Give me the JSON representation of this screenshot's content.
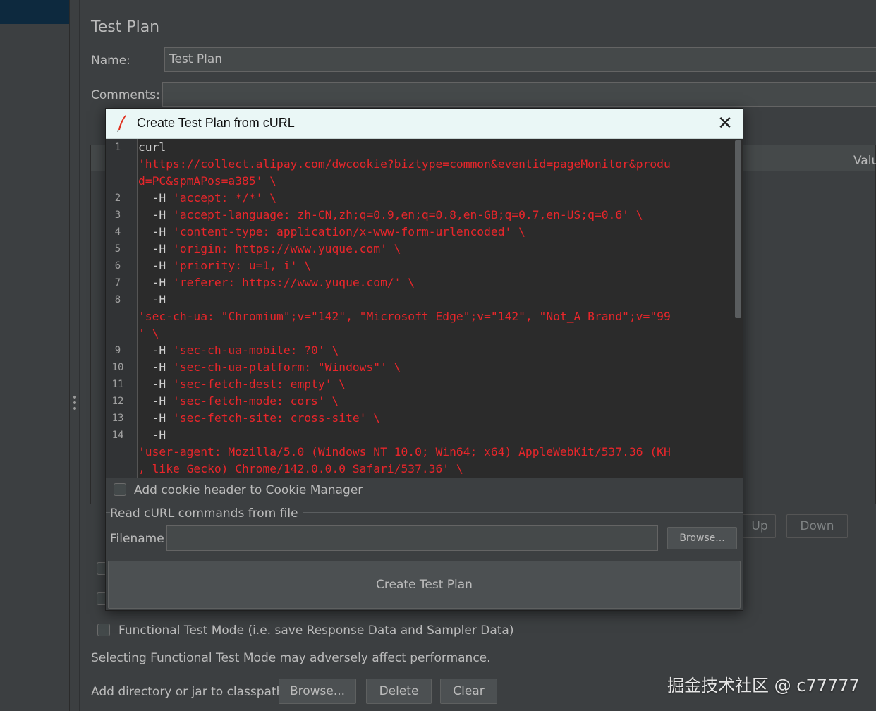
{
  "panel": {
    "title": "Test Plan",
    "name_label": "Name:",
    "name_value": "Test Plan",
    "comments_label": "Comments:",
    "comments_value": "",
    "table_col_value": "Valu",
    "up_label": "Up",
    "down_label": "Down",
    "functional_mode_label": "Functional Test Mode (i.e. save Response Data and Sampler Data)",
    "functional_mode_note": "Selecting Functional Test Mode may adversely affect performance.",
    "classpath_label": "Add directory or jar to classpath",
    "browse_label": "Browse...",
    "delete_label": "Delete",
    "clear_label": "Clear"
  },
  "dialog": {
    "title": "Create Test Plan from cURL",
    "close_icon": "close-icon",
    "code_lines": [
      {
        "num": "1",
        "segs": [
          {
            "t": "curl",
            "c": "plain"
          }
        ]
      },
      {
        "num": "",
        "segs": [
          {
            "t": "'https://collect.alipay.com/dwcookie?biztype=common&eventid=pageMonitor&produ",
            "c": "str"
          }
        ]
      },
      {
        "num": "",
        "segs": [
          {
            "t": "d=PC&spmAPos=a385' \\",
            "c": "str"
          }
        ]
      },
      {
        "num": "2",
        "segs": [
          {
            "t": "  -H ",
            "c": "plain"
          },
          {
            "t": "'accept: */*' \\",
            "c": "str"
          }
        ]
      },
      {
        "num": "3",
        "segs": [
          {
            "t": "  -H ",
            "c": "plain"
          },
          {
            "t": "'accept-language: zh-CN,zh;q=0.9,en;q=0.8,en-GB;q=0.7,en-US;q=0.6' \\",
            "c": "str"
          }
        ]
      },
      {
        "num": "4",
        "segs": [
          {
            "t": "  -H ",
            "c": "plain"
          },
          {
            "t": "'content-type: application/x-www-form-urlencoded' \\",
            "c": "str"
          }
        ]
      },
      {
        "num": "5",
        "segs": [
          {
            "t": "  -H ",
            "c": "plain"
          },
          {
            "t": "'origin: https://www.yuque.com' \\",
            "c": "str"
          }
        ]
      },
      {
        "num": "6",
        "segs": [
          {
            "t": "  -H ",
            "c": "plain"
          },
          {
            "t": "'priority: u=1, i' \\",
            "c": "str"
          }
        ]
      },
      {
        "num": "7",
        "segs": [
          {
            "t": "  -H ",
            "c": "plain"
          },
          {
            "t": "'referer: https://www.yuque.com/' \\",
            "c": "str"
          }
        ]
      },
      {
        "num": "8",
        "segs": [
          {
            "t": "  -H",
            "c": "plain"
          }
        ]
      },
      {
        "num": "",
        "segs": [
          {
            "t": "'sec-ch-ua: \"Chromium\";v=\"142\", \"Microsoft Edge\";v=\"142\", \"Not_A Brand\";v=\"99",
            "c": "str"
          }
        ]
      },
      {
        "num": "",
        "segs": [
          {
            "t": "' \\",
            "c": "str"
          }
        ]
      },
      {
        "num": "9",
        "segs": [
          {
            "t": "  -H ",
            "c": "plain"
          },
          {
            "t": "'sec-ch-ua-mobile: ?0' \\",
            "c": "str"
          }
        ]
      },
      {
        "num": "10",
        "segs": [
          {
            "t": "  -H ",
            "c": "plain"
          },
          {
            "t": "'sec-ch-ua-platform: \"Windows\"' \\",
            "c": "str"
          }
        ]
      },
      {
        "num": "11",
        "segs": [
          {
            "t": "  -H ",
            "c": "plain"
          },
          {
            "t": "'sec-fetch-dest: empty' \\",
            "c": "str"
          }
        ]
      },
      {
        "num": "12",
        "segs": [
          {
            "t": "  -H ",
            "c": "plain"
          },
          {
            "t": "'sec-fetch-mode: cors' \\",
            "c": "str"
          }
        ]
      },
      {
        "num": "13",
        "segs": [
          {
            "t": "  -H ",
            "c": "plain"
          },
          {
            "t": "'sec-fetch-site: cross-site' \\",
            "c": "str"
          }
        ]
      },
      {
        "num": "14",
        "segs": [
          {
            "t": "  -H",
            "c": "plain"
          }
        ]
      },
      {
        "num": "",
        "segs": [
          {
            "t": "'user-agent: Mozilla/5.0 (Windows NT 10.0; Win64; x64) AppleWebKit/537.36 (KH",
            "c": "str"
          }
        ]
      },
      {
        "num": "",
        "segs": [
          {
            "t": ", like Gecko) Chrome/142.0.0.0 Safari/537.36' \\",
            "c": "str"
          }
        ]
      }
    ],
    "cookie_checkbox_label": "Add cookie header to Cookie Manager",
    "cookie_checked": false,
    "read_from_file_label": "Read cURL commands from file",
    "filename_label": "Filename",
    "filename_value": "",
    "browse_label": "Browse...",
    "create_label": "Create Test Plan"
  },
  "watermark": "掘金技术社区 @ c77777",
  "colors": {
    "background": "#3c3f41",
    "editor_bg": "#2b2b2b",
    "string_red": "#e8262b",
    "titlebar": "#eaf7f6"
  }
}
